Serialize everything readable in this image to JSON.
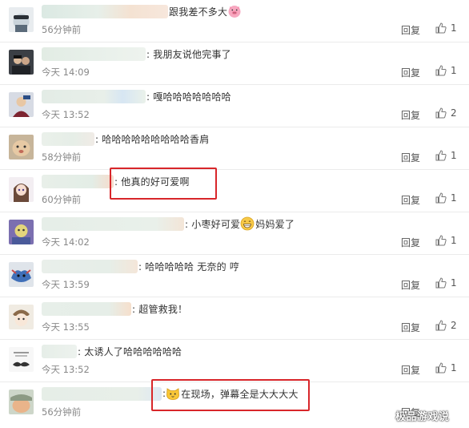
{
  "actions": {
    "reply_label": "回复"
  },
  "comments": [
    {
      "username": "",
      "text": "跟我差不多大",
      "emoji_after": "pig-face-icon",
      "time": "56分钟前",
      "likes": "1"
    },
    {
      "username": "",
      "text": ": 我朋友说他完事了",
      "time": "今天 14:09",
      "likes": "1"
    },
    {
      "username": "",
      "text": ": 嘎哈哈哈哈哈哈哈",
      "time": "今天 13:52",
      "likes": "2"
    },
    {
      "username": "",
      "text": ": 哈哈哈哈哈哈哈哈哈香肩",
      "time": "58分钟前",
      "likes": "1"
    },
    {
      "username": "",
      "text": ": 他真的好可爱啊",
      "time": "60分钟前",
      "likes": "1"
    },
    {
      "username": "",
      "text_before": ": 小枣好可爱",
      "emoji_mid": "grinning-face-icon",
      "text_after": "妈妈爱了",
      "time": "今天 14:02",
      "likes": "1"
    },
    {
      "username": "",
      "text": ": 哈哈哈哈哈 无奈的 哼",
      "time": "今天 13:59",
      "likes": "1"
    },
    {
      "username": "",
      "text": ": 超管救我！",
      "time": "今天 13:55",
      "likes": "2"
    },
    {
      "username": "",
      "text": ": 太诱人了哈哈哈哈哈哈",
      "time": "今天 13:52",
      "likes": "1"
    },
    {
      "username": "",
      "text_before": ":",
      "emoji_mid": "cat-face-icon",
      "text_after": "在现场，弹幕全是大大大大",
      "time": "56分钟前",
      "likes": ""
    }
  ],
  "watermark": "极品游戏说",
  "colors": {
    "highlight_border": "#d8262a",
    "divider": "#ebebeb",
    "meta_text": "#888888"
  }
}
